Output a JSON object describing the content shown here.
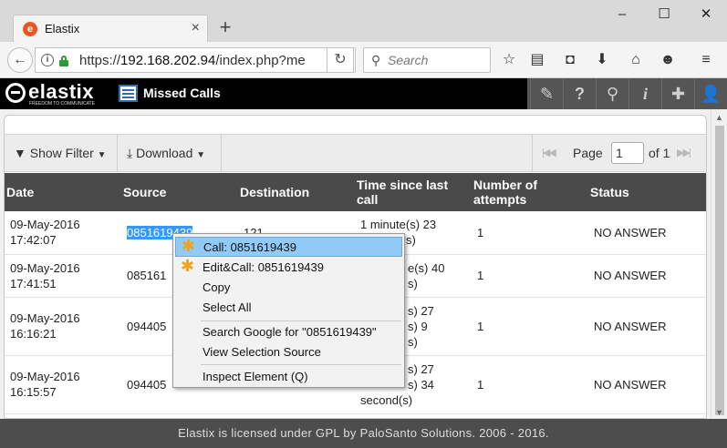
{
  "browser": {
    "tab_title": "Elastix",
    "url_prefix": "https://",
    "url_host": "192.168.202.94",
    "url_path": "/index.php?me",
    "search_placeholder": "Search"
  },
  "app": {
    "logo_word": "elastix",
    "logo_tagline": "FREEDOM TO COMMUNICATE",
    "module_title": "Missed Calls"
  },
  "toolbar": {
    "show_filter": "Show Filter",
    "download": "Download",
    "page_label": "Page",
    "page_value": "1",
    "page_of": "of 1"
  },
  "table": {
    "columns": [
      "Date",
      "Source",
      "Destination",
      "Time since last call",
      "Number of attempts",
      "Status"
    ],
    "rows": [
      {
        "date_line1": "09-May-2016",
        "date_line2": "17:42:07",
        "source": "0851619439",
        "destination": "121",
        "time_line1": "1 minute(s) 23",
        "time_line2": "s)",
        "time_line3": "",
        "attempts": "1",
        "status": "NO ANSWER"
      },
      {
        "date_line1": "09-May-2016",
        "date_line2": "17:41:51",
        "source": "085161",
        "destination": "",
        "time_line1": "e(s) 40",
        "time_line2": "s)",
        "time_line3": "",
        "attempts": "1",
        "status": "NO ANSWER"
      },
      {
        "date_line1": "09-May-2016",
        "date_line2": "16:16:21",
        "source": "094405",
        "destination": "",
        "time_line1": "s) 27",
        "time_line2": "s) 9",
        "time_line3": "s)",
        "attempts": "1",
        "status": "NO ANSWER"
      },
      {
        "date_line1": "09-May-2016",
        "date_line2": "16:15:57",
        "source": "094405",
        "destination": "",
        "time_line1": "s) 27",
        "time_line2": "s) 34",
        "time_line3": "second(s)",
        "attempts": "1",
        "status": "NO ANSWER"
      }
    ]
  },
  "context_menu": {
    "call": "Call: 0851619439",
    "edit_call": "Edit&Call: 0851619439",
    "copy": "Copy",
    "select_all": "Select All",
    "search_google": "Search Google for \"0851619439\"",
    "view_selection_source": "View Selection Source",
    "inspect_element": "Inspect Element (Q)"
  },
  "footer": "Elastix is licensed under GPL by PaloSanto Solutions. 2006 - 2016."
}
